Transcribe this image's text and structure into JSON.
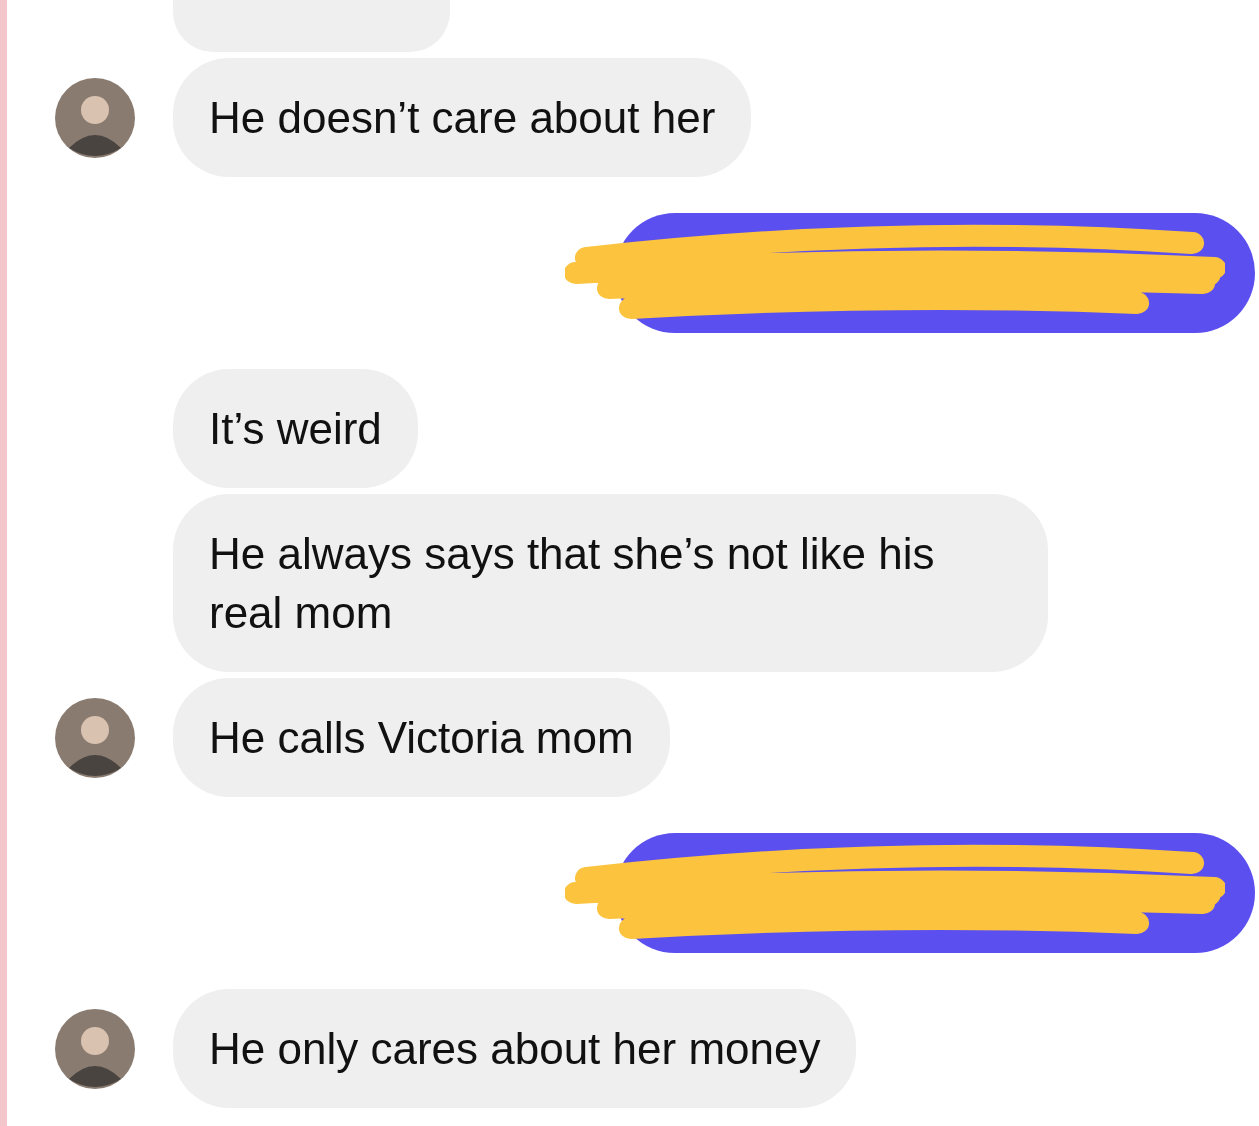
{
  "messages": [
    {
      "kind": "partial"
    },
    {
      "kind": "received",
      "text": "He doesn’t care about her",
      "avatar": true
    },
    {
      "kind": "redacted"
    },
    {
      "kind": "received",
      "text": "It’s weird",
      "avatar": false
    },
    {
      "kind": "received",
      "text": "He always says that she’s not like his real mom",
      "avatar": false
    },
    {
      "kind": "received",
      "text": "He calls Victoria mom",
      "avatar": true
    },
    {
      "kind": "redacted"
    },
    {
      "kind": "received",
      "text": "He only cares about her money",
      "avatar": true
    }
  ]
}
